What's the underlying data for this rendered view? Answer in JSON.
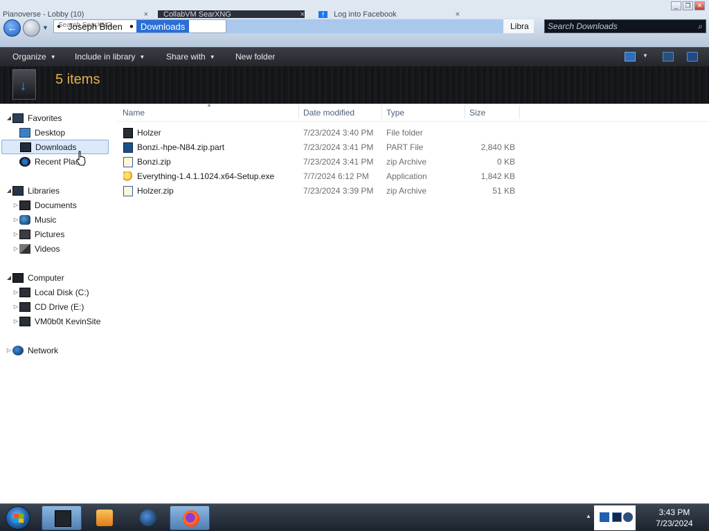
{
  "browser": {
    "tabs": [
      {
        "label": "Pianoverse - Lobby (10)"
      },
      {
        "label": "CollabVM SearXNG"
      },
      {
        "label": "Log into Facebook"
      }
    ],
    "tab_close": "×"
  },
  "window_controls": {
    "minimize": "_",
    "restore": "❐",
    "close": "✕"
  },
  "address_bar": {
    "ghost_text": "Search SearXNG",
    "crumbs": [
      "Joseph Biden",
      "Downloads"
    ],
    "right_label": "Libra",
    "search_placeholder": "Search Downloads"
  },
  "toolbar": {
    "organize": "Organize",
    "include_in_library": "Include in library",
    "share_with": "Share with",
    "new_folder": "New folder"
  },
  "banner": {
    "item_count": "5 items"
  },
  "nav_pane": {
    "favorites": "Favorites",
    "desktop": "Desktop",
    "downloads": "Downloads",
    "recent_places": "Recent Places",
    "libraries": "Libraries",
    "documents": "Documents",
    "music": "Music",
    "pictures": "Pictures",
    "videos": "Videos",
    "computer": "Computer",
    "local_disk": "Local Disk (C:)",
    "cd_drive": "CD Drive (E:)",
    "network_share": "VM0b0t KevinSite",
    "network": "Network"
  },
  "columns": {
    "name": "Name",
    "date_modified": "Date modified",
    "type": "Type",
    "size": "Size"
  },
  "files": [
    {
      "name": "Holzer",
      "date": "7/23/2024 3:40 PM",
      "type": "File folder",
      "size": "",
      "icon": "folder-icon"
    },
    {
      "name": "Bonzi.-hpe-N84.zip.part",
      "date": "7/23/2024 3:41 PM",
      "type": "PART File",
      "size": "2,840 KB",
      "icon": "part-file-icon"
    },
    {
      "name": "Bonzi.zip",
      "date": "7/23/2024 3:41 PM",
      "type": "zip Archive",
      "size": "0 KB",
      "icon": "zip-icon"
    },
    {
      "name": "Everything-1.4.1.1024.x64-Setup.exe",
      "date": "7/7/2024 6:12 PM",
      "type": "Application",
      "size": "1,842 KB",
      "icon": "magnifier-app-icon"
    },
    {
      "name": "Holzer.zip",
      "date": "7/23/2024 3:39 PM",
      "type": "zip Archive",
      "size": "51 KB",
      "icon": "zip-icon"
    }
  ],
  "taskbar": {
    "clock_time": "3:43 PM",
    "clock_date": "7/23/2024"
  },
  "colors": {
    "accent": "#2a6fd6",
    "item_count": "#e4b24a",
    "toolbar_bg": "#2a2d33"
  }
}
